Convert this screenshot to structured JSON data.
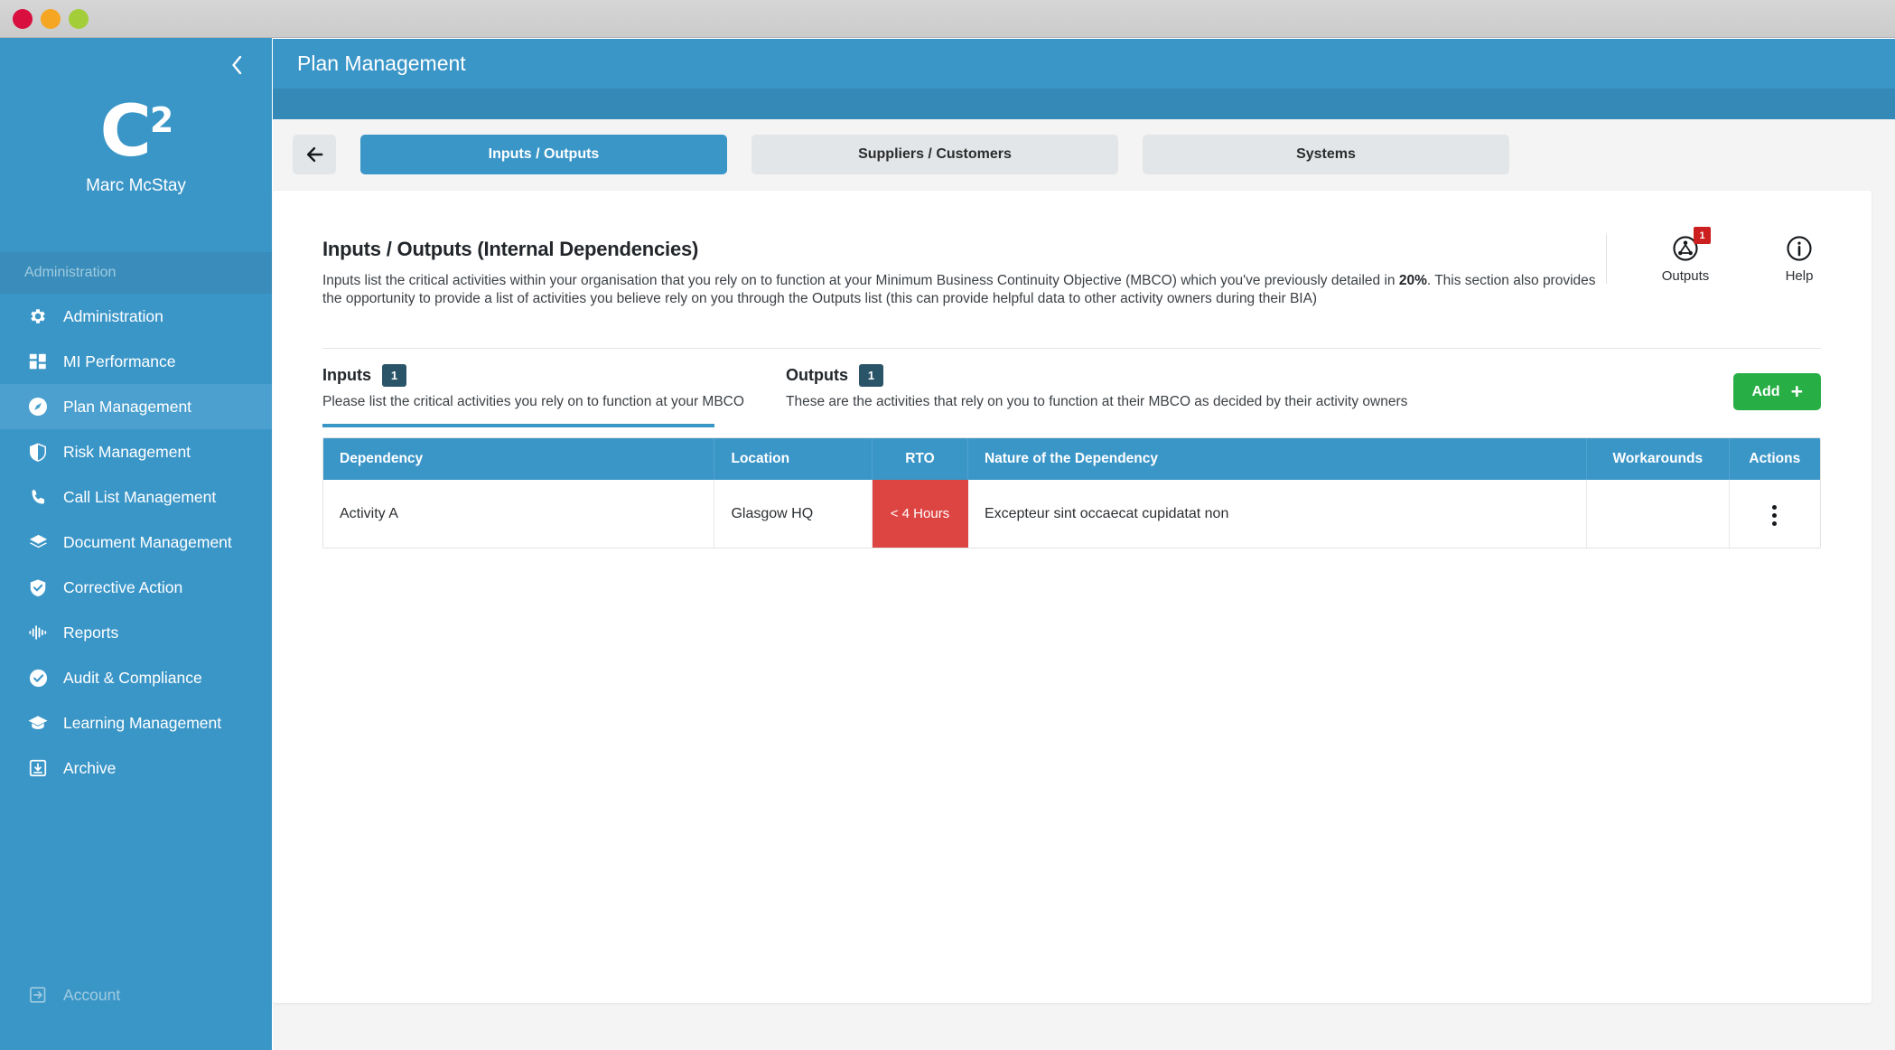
{
  "window": {
    "traffic_lights": [
      {
        "name": "close",
        "color": "#d80f3f"
      },
      {
        "name": "minimize",
        "color": "#f5a623"
      },
      {
        "name": "zoom",
        "color": "#a4ce39"
      }
    ]
  },
  "sidebar": {
    "collapse_icon": "chevron-left-icon",
    "logo_text": "C",
    "logo_sup": "2",
    "username": "Marc McStay",
    "section_label": "Administration",
    "items": [
      {
        "label": "Administration",
        "icon": "gear-icon",
        "active": false
      },
      {
        "label": "MI Performance",
        "icon": "dashboard-grid-icon",
        "active": false
      },
      {
        "label": "Plan Management",
        "icon": "compass-icon",
        "active": true
      },
      {
        "label": "Risk Management",
        "icon": "shield-split-icon",
        "active": false
      },
      {
        "label": "Call List Management",
        "icon": "phone-icon",
        "active": false
      },
      {
        "label": "Document Management",
        "icon": "layers-icon",
        "active": false
      },
      {
        "label": "Corrective Action",
        "icon": "shield-check-icon",
        "active": false
      },
      {
        "label": "Reports",
        "icon": "waveform-icon",
        "active": false
      },
      {
        "label": "Audit & Compliance",
        "icon": "check-circle-icon",
        "active": false
      },
      {
        "label": "Learning Management",
        "icon": "graduation-cap-icon",
        "active": false
      },
      {
        "label": "Archive",
        "icon": "archive-box-icon",
        "active": false
      }
    ],
    "account": {
      "label": "Account",
      "icon": "logout-icon"
    }
  },
  "header": {
    "title": "Plan Management"
  },
  "tabs": {
    "back_icon": "arrow-left-icon",
    "items": [
      {
        "label": "Inputs / Outputs",
        "active": true
      },
      {
        "label": "Suppliers / Customers",
        "active": false
      },
      {
        "label": "Systems",
        "active": false
      }
    ]
  },
  "panel": {
    "title": "Inputs / Outputs (Internal Dependencies)",
    "description_part1": "Inputs list the critical activities within your organisation that you rely on to function at your Minimum Business Continuity Objective (MBCO) which you've previously detailed in ",
    "description_bold": "20%",
    "description_part2": ". This section also provides the opportunity to provide a list of activities you believe rely on you through the Outputs list (this can provide helpful data to other activity owners during their BIA)",
    "actions": [
      {
        "label": "Outputs",
        "icon": "network-share-icon",
        "badge": "1"
      },
      {
        "label": "Help",
        "icon": "info-circle-icon",
        "badge": ""
      }
    ]
  },
  "io": {
    "inputs": {
      "title": "Inputs",
      "badge": "1",
      "subtitle": "Please list the critical activities you rely on to function at your MBCO"
    },
    "outputs": {
      "title": "Outputs",
      "badge": "1",
      "subtitle": "These are the activities that rely on you to function at their MBCO as decided by their activity owners"
    },
    "add_label": "Add",
    "add_icon": "plus-icon"
  },
  "table": {
    "columns": [
      {
        "key": "dependency",
        "label": "Dependency",
        "align": "left"
      },
      {
        "key": "location",
        "label": "Location",
        "align": "left"
      },
      {
        "key": "rto",
        "label": "RTO",
        "align": "center"
      },
      {
        "key": "nature",
        "label": "Nature of the Dependency",
        "align": "left"
      },
      {
        "key": "workarounds",
        "label": "Workarounds",
        "align": "center"
      },
      {
        "key": "actions",
        "label": "Actions",
        "align": "center"
      }
    ],
    "rows": [
      {
        "dependency": "Activity A",
        "location": "Glasgow HQ",
        "rto": "< 4 Hours",
        "rto_color": "#dd4543",
        "nature": "Excepteur sint occaecat cupidatat non",
        "workarounds": "",
        "actions_icon": "kebab-menu-icon"
      }
    ]
  }
}
